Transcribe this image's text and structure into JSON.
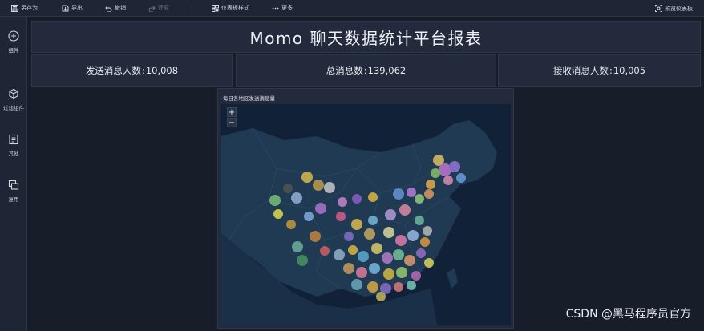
{
  "toolbar": {
    "save_as": "另存为",
    "export": "导出",
    "undo": "撤销",
    "redo": "还原",
    "dashboard_style": "仪表板样式",
    "more": "更多",
    "preview": "预览仪表板"
  },
  "sidebar": {
    "items": [
      {
        "label": "组件",
        "icon": "plus-circle-icon"
      },
      {
        "label": "过滤组件",
        "icon": "cube-icon"
      },
      {
        "label": "其他",
        "icon": "document-icon"
      },
      {
        "label": "复用",
        "icon": "copy-icon"
      }
    ]
  },
  "dashboard": {
    "title": "Momo 聊天数据统计平台报表",
    "stats": [
      {
        "label": "发送消息人数",
        "value": "10,008"
      },
      {
        "label": "总消息数",
        "value": "139,062"
      },
      {
        "label": "接收消息人数",
        "value": "10,005"
      }
    ],
    "stat_separator": ":",
    "map": {
      "title": "每日各地区发送消息量",
      "zoom_in": "+",
      "zoom_out": "−"
    }
  },
  "watermark": "CSDN @黑马程序员官方",
  "colors": {
    "background": "#1b2130",
    "panel": "#232a3b",
    "map_ocean": "#112238",
    "map_land": "#1f3a52"
  }
}
